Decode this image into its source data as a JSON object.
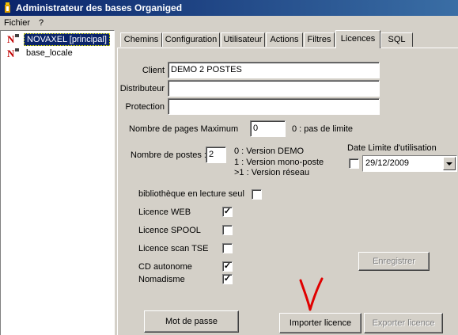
{
  "window": {
    "title": "Administrateur des bases Organiged"
  },
  "menu": {
    "items": [
      "Fichier",
      "?"
    ]
  },
  "tree": {
    "items": [
      {
        "label": "NOVAXEL [principal]"
      },
      {
        "label": "base_locale"
      }
    ]
  },
  "tabs": [
    "Chemins",
    "Configuration",
    "Utilisateur",
    "Actions",
    "Filtres",
    "Licences",
    "SQL"
  ],
  "active_tab": "Licences",
  "form": {
    "client_label": "Client",
    "client_value": "DEMO 2 POSTES",
    "distributeur_label": "Distributeur",
    "distributeur_value": "",
    "protection_label": "Protection",
    "protection_value": "",
    "max_pages_label": "Nombre de pages Maximum",
    "max_pages_value": "0",
    "max_pages_hint": "0 :  pas de limite",
    "postes_label": "Nombre de postes :",
    "postes_value": "2",
    "postes_hint_1": "0 : Version DEMO",
    "postes_hint_2": "1 : Version mono-poste",
    "postes_hint_3": ">1  : Version réseau",
    "date_limite_label": "Date Limite d'utilisation",
    "date_limite_checked": false,
    "date_limite_value": "29/12/2009",
    "bibliotheque_label": "bibliothèque en lecture seul",
    "bibliotheque_checked": false,
    "options": [
      {
        "label": "Licence WEB",
        "checked": true
      },
      {
        "label": "Licence SPOOL",
        "checked": false
      },
      {
        "label": "Licence scan TSE",
        "checked": false
      },
      {
        "label": "CD autonome",
        "checked": true
      },
      {
        "label": "Nomadisme",
        "checked": true
      }
    ]
  },
  "buttons": {
    "enregistrer": "Enregistrer",
    "mot_de_passe": "Mot de passe",
    "importer": "Importer licence",
    "exporter": "Exporter licence"
  },
  "annotation_color": "#e00000"
}
